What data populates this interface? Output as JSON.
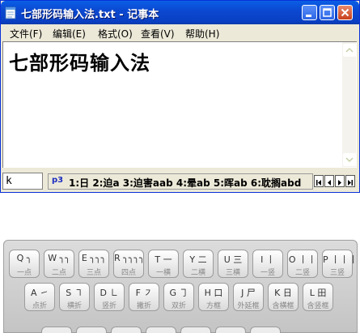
{
  "window": {
    "title": "七部形码输入法.txt - 记事本",
    "menu": {
      "file": "文件(F)",
      "edit": "编辑(E)",
      "format": "格式(O)",
      "view": "查看(V)",
      "help": "帮助(H)"
    },
    "editor_text": "七部形码输入法"
  },
  "ime": {
    "input": "k",
    "page_icon": "p3",
    "candidates": "1:日 2:迫a 3:迫害aab 4:晕ab 5:晖ab 6:耽搁abd"
  },
  "keyboard": {
    "row1": [
      {
        "key": "Q ╮",
        "sub": "一点"
      },
      {
        "key": "W ╮╮",
        "sub": "二点"
      },
      {
        "key": "E ╮╮╮",
        "sub": "三点"
      },
      {
        "key": "R ╮╮╮╮",
        "sub": "四点"
      },
      {
        "key": "T 一",
        "sub": "一横"
      },
      {
        "key": "Y 二",
        "sub": "二横"
      },
      {
        "key": "U 三",
        "sub": "三横"
      },
      {
        "key": "I 丨",
        "sub": "一竖"
      },
      {
        "key": "O 丨丨",
        "sub": "二竖"
      },
      {
        "key": "P 丨丨丨",
        "sub": "三竖"
      }
    ],
    "row2": [
      {
        "key": "A ㇀",
        "sub": "点折"
      },
      {
        "key": "S ㇕",
        "sub": "横折"
      },
      {
        "key": "D ㇗",
        "sub": "竖折"
      },
      {
        "key": "F ㇇",
        "sub": "撇折"
      },
      {
        "key": "G ㇆",
        "sub": "双折"
      },
      {
        "key": "H 口",
        "sub": "方框"
      },
      {
        "key": "J 尸",
        "sub": "外延框"
      },
      {
        "key": "K 日",
        "sub": "含横框"
      },
      {
        "key": "L 田",
        "sub": "含竖框"
      }
    ]
  }
}
